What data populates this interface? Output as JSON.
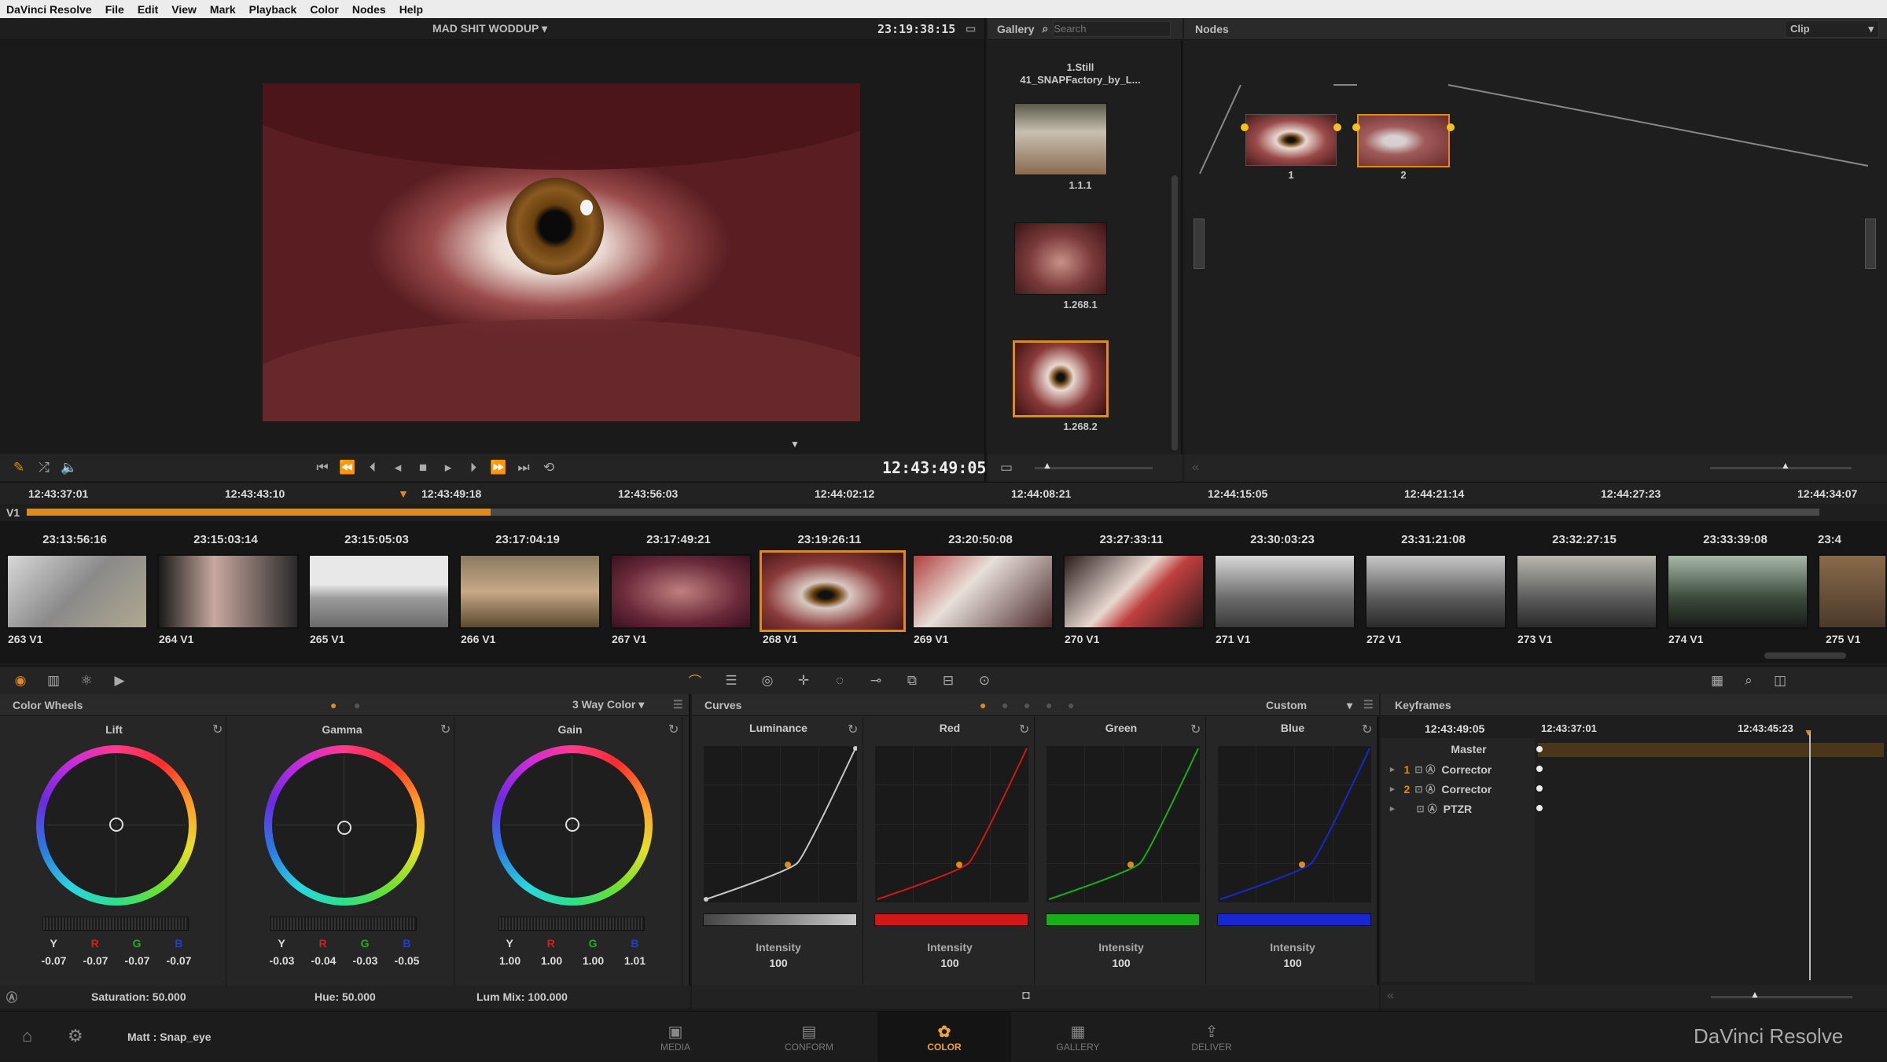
{
  "menu": [
    "DaVinci Resolve",
    "File",
    "Edit",
    "View",
    "Mark",
    "Playback",
    "Color",
    "Nodes",
    "Help"
  ],
  "viewer": {
    "project_title": "MAD SHIT WODDUP",
    "record_tc": "23:19:38:15",
    "current_tc": "12:43:49:05"
  },
  "gallery": {
    "title": "Gallery",
    "search_placeholder": "Search",
    "top_label_1": "1.Still",
    "top_label_2": "41_SNAPFactory_by_L...",
    "stills": [
      "1.1.1",
      "1.268.1",
      "1.268.2"
    ]
  },
  "nodes": {
    "title": "Nodes",
    "mode": "Clip",
    "node_labels": [
      "1",
      "2"
    ]
  },
  "timeline": {
    "track": "V1",
    "ruler": [
      "12:43:37:01",
      "12:43:43:10",
      "12:43:49:18",
      "12:43:56:03",
      "12:44:02:12",
      "12:44:08:21",
      "12:44:15:05",
      "12:44:21:14",
      "12:44:27:23",
      "12:44:34:07"
    ]
  },
  "clips": [
    {
      "tc": "23:13:56:16",
      "label": "263 V1"
    },
    {
      "tc": "23:15:03:14",
      "label": "264 V1"
    },
    {
      "tc": "23:15:05:03",
      "label": "265 V1"
    },
    {
      "tc": "23:17:04:19",
      "label": "266 V1"
    },
    {
      "tc": "23:17:49:21",
      "label": "267 V1"
    },
    {
      "tc": "23:19:26:11",
      "label": "268 V1"
    },
    {
      "tc": "23:20:50:08",
      "label": "269 V1"
    },
    {
      "tc": "23:27:33:11",
      "label": "270 V1"
    },
    {
      "tc": "23:30:03:23",
      "label": "271 V1"
    },
    {
      "tc": "23:31:21:08",
      "label": "272 V1"
    },
    {
      "tc": "23:32:27:15",
      "label": "273 V1"
    },
    {
      "tc": "23:33:39:08",
      "label": "274 V1"
    },
    {
      "tc": "23:4",
      "label": "275 V1"
    }
  ],
  "color_wheels": {
    "title": "Color Wheels",
    "mode": "3 Way Color",
    "wheels": [
      {
        "name": "Lift",
        "y": "-0.07",
        "r": "-0.07",
        "g": "-0.07",
        "b": "-0.07"
      },
      {
        "name": "Gamma",
        "y": "-0.03",
        "r": "-0.04",
        "g": "-0.03",
        "b": "-0.05"
      },
      {
        "name": "Gain",
        "y": "1.00",
        "r": "1.00",
        "g": "1.00",
        "b": "1.01"
      }
    ],
    "channel_labels": [
      "Y",
      "R",
      "G",
      "B"
    ],
    "saturation_label": "Saturation:",
    "saturation": "50.000",
    "hue_label": "Hue:",
    "hue": "50.000",
    "lummix_label": "Lum Mix:",
    "lummix": "100.000"
  },
  "curves": {
    "title": "Curves",
    "mode": "Custom",
    "channels": [
      {
        "name": "Luminance",
        "intensity_label": "Intensity",
        "intensity": "100",
        "color": "#c8c8c8"
      },
      {
        "name": "Red",
        "intensity_label": "Intensity",
        "intensity": "100",
        "color": "#d01818"
      },
      {
        "name": "Green",
        "intensity_label": "Intensity",
        "intensity": "100",
        "color": "#18b018"
      },
      {
        "name": "Blue",
        "intensity_label": "Intensity",
        "intensity": "100",
        "color": "#1828d0"
      }
    ]
  },
  "keyframes": {
    "title": "Keyframes",
    "current_tc": "12:43:49:05",
    "ruler": [
      "12:43:37:01",
      "12:43:45:23"
    ],
    "rows": [
      {
        "num": "",
        "name": "Master"
      },
      {
        "num": "1",
        "name": "Corrector"
      },
      {
        "num": "2",
        "name": "Corrector"
      },
      {
        "num": "",
        "name": "PTZR"
      }
    ]
  },
  "status": {
    "user": "Matt : Snap_eye",
    "brand": "DaVinci Resolve"
  },
  "pages": [
    "MEDIA",
    "CONFORM",
    "COLOR",
    "GALLERY",
    "DELIVER"
  ],
  "colors": {
    "accent": "#e08a1e",
    "active_tab": "#e9a23b"
  }
}
